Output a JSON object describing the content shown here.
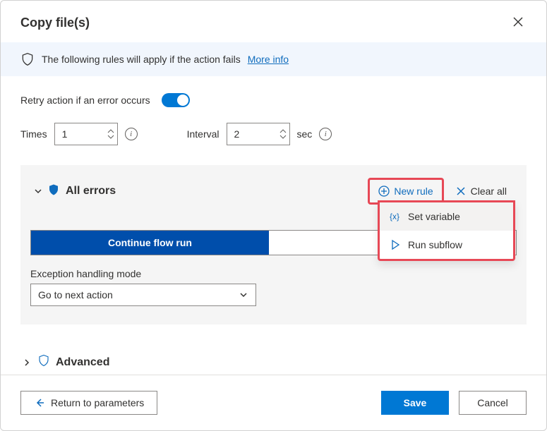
{
  "header": {
    "title": "Copy file(s)"
  },
  "info": {
    "text": "The following rules will apply if the action fails",
    "link": "More info"
  },
  "retry": {
    "label": "Retry action if an error occurs",
    "times_label": "Times",
    "times_value": "1",
    "interval_label": "Interval",
    "interval_value": "2",
    "interval_unit": "sec"
  },
  "errors": {
    "title": "All errors",
    "new_rule": "New rule",
    "clear_all": "Clear all",
    "menu": {
      "set_variable": "Set variable",
      "run_subflow": "Run subflow"
    },
    "continue_label": "Continue flow run",
    "exception_label": "Exception handling mode",
    "exception_value": "Go to next action"
  },
  "advanced": {
    "label": "Advanced"
  },
  "footer": {
    "return": "Return to parameters",
    "save": "Save",
    "cancel": "Cancel"
  }
}
